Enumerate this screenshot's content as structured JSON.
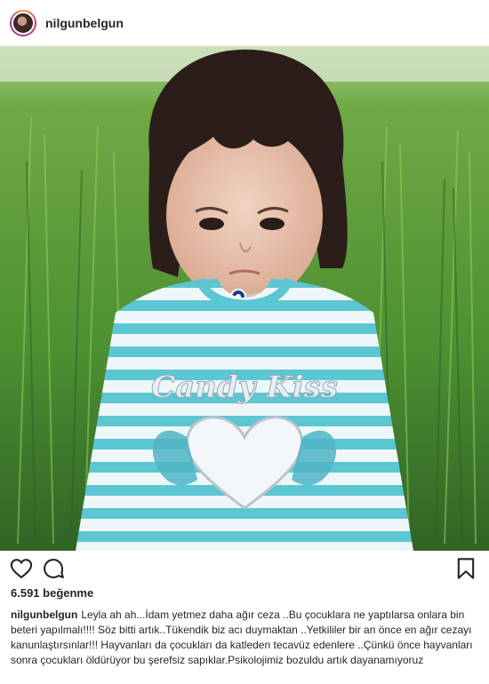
{
  "post": {
    "username": "nilgunbelgun",
    "photo_subject": "Candy Kiss",
    "likes_text": "6.591 beğenme",
    "caption_text": "Leyla ah ah...İdam yetmez daha ağır ceza ..Bu çocuklara ne yaptılarsa onlara bin beteri yapılmalı!!!! Söz bitti artık..Tükendik biz acı duymaktan ..Yetkililer bir an önce en ağır cezayı kanunlaştırsınlar!!! Hayvanları da çocukları da katleden tecavüz edenlere ..Çünkü önce hayvanları sonra çocukları öldürüyor bu şerefsiz sapıklar.Psikolojimiz bozuldu artık dayanamıyoruz"
  },
  "icons": {
    "like": "heart-icon",
    "comment": "comment-icon",
    "save": "bookmark-icon"
  },
  "colors": {
    "grass_dark": "#3f7a2e",
    "grass_light": "#7fbf4f",
    "stripe_teal": "#5cc6d3",
    "text": "#262626"
  }
}
